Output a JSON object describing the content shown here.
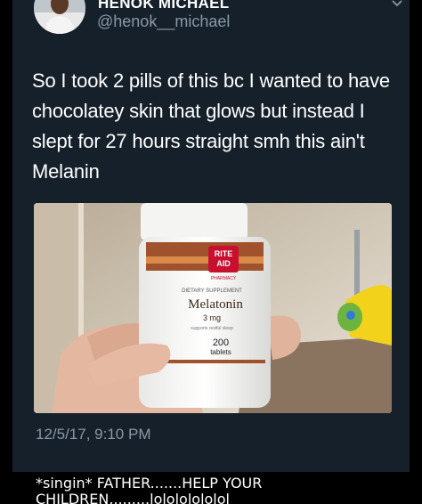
{
  "tweet": {
    "display_name": "HENOK MICHAEL",
    "handle": "@henok__michael",
    "text": "So I took 2 pills of this bc I wanted to have chocolatey skin that glows but instead I slept for 27 hours straight smh this ain't Melanin",
    "timestamp": "12/5/17, 9:10 PM",
    "icons": {
      "avatar": "profile-photo",
      "menu": "chevron-down-icon"
    },
    "media": {
      "label_brand_line1": "RITE",
      "label_brand_line2": "AID",
      "label_pharmacy": "PHARMACY",
      "label_supplement": "DIETARY SUPPLEMENT",
      "label_product": "Melatonin",
      "label_dose": "3 mg",
      "label_support": "supports restful sleep",
      "label_count": "200",
      "label_unit": "tablets"
    }
  },
  "caption": {
    "line1": "*singin* FATHER.......HELP YOUR",
    "line2": "CHILDREN.........lolololololol"
  },
  "colors": {
    "background": "#000000",
    "tweet_bg": "#15202b",
    "text_primary": "#ffffff",
    "text_secondary": "#8899a6",
    "brand_red": "#c8102e"
  }
}
